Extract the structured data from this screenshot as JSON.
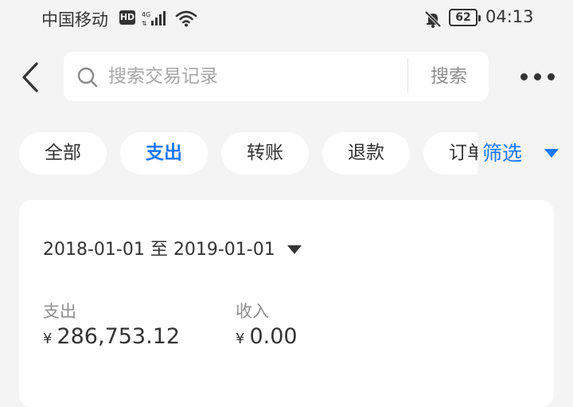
{
  "status_bar": {
    "carrier": "中国移动",
    "hd": "HD",
    "battery": "62",
    "time": "04:13"
  },
  "search": {
    "placeholder": "搜索交易记录",
    "button_label": "搜索"
  },
  "tabs": [
    {
      "label": "全部"
    },
    {
      "label": "支出"
    },
    {
      "label": "转账"
    },
    {
      "label": "退款"
    },
    {
      "label": "订单"
    }
  ],
  "active_tab": "支出",
  "filter": {
    "label": "筛选"
  },
  "summary": {
    "date_range": "2018-01-01 至 2019-01-01",
    "expense_label": "支出",
    "expense_currency": "¥",
    "expense_value": "286,753.12",
    "income_label": "收入",
    "income_currency": "¥",
    "income_value": "0.00"
  },
  "colors": {
    "accent": "#1677ff",
    "background": "#f4f4f4",
    "card": "#ffffff"
  }
}
